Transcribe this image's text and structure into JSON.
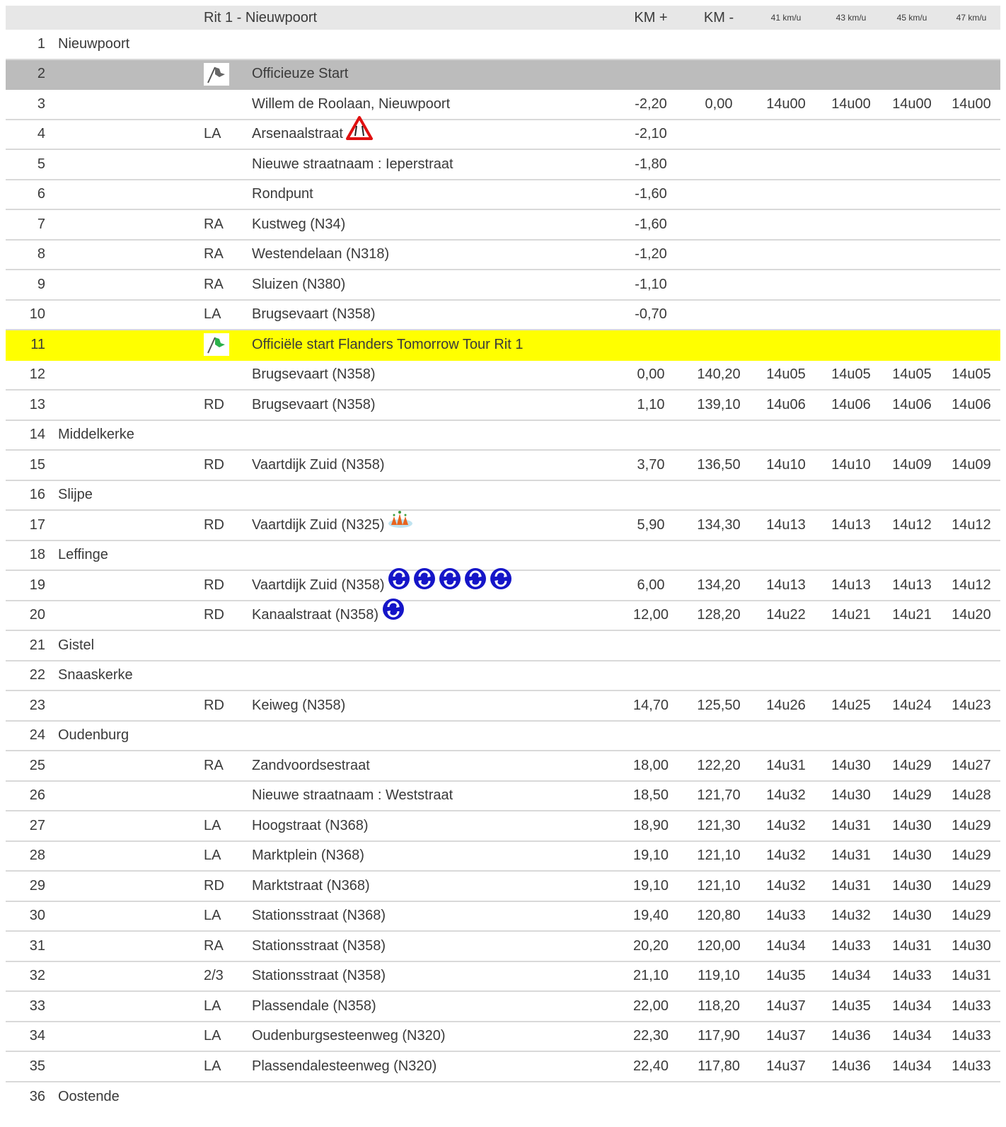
{
  "header": {
    "title": "Rit 1 - Nieuwpoort",
    "km_plus": "KM +",
    "km_minus": "KM -",
    "speeds": [
      "41 km/u",
      "43 km/u",
      "45 km/u",
      "47 km/u"
    ]
  },
  "rows": [
    {
      "n": "1",
      "place": "Nieuwpoort",
      "action": "",
      "street": "",
      "kmp": "",
      "kmm": "",
      "t": [
        "",
        "",
        "",
        ""
      ]
    },
    {
      "n": "2",
      "place": "",
      "action": "",
      "street": "Officieuze Start",
      "kmp": "",
      "kmm": "",
      "t": [
        "",
        "",
        "",
        ""
      ]
    },
    {
      "n": "3",
      "place": "",
      "action": "",
      "street": "Willem de Roolaan, Nieuwpoort",
      "kmp": "-2,20",
      "kmm": "0,00",
      "t": [
        "14u00",
        "14u00",
        "14u00",
        "14u00"
      ]
    },
    {
      "n": "4",
      "place": "",
      "action": "LA",
      "street": "Arsenaalstraat",
      "kmp": "-2,10",
      "kmm": "",
      "t": [
        "",
        "",
        "",
        ""
      ]
    },
    {
      "n": "5",
      "place": "",
      "action": "",
      "street": "Nieuwe straatnaam : Ieperstraat",
      "kmp": "-1,80",
      "kmm": "",
      "t": [
        "",
        "",
        "",
        ""
      ]
    },
    {
      "n": "6",
      "place": "",
      "action": "",
      "street": "Rondpunt",
      "kmp": "-1,60",
      "kmm": "",
      "t": [
        "",
        "",
        "",
        ""
      ]
    },
    {
      "n": "7",
      "place": "",
      "action": "RA",
      "street": "Kustweg (N34)",
      "kmp": "-1,60",
      "kmm": "",
      "t": [
        "",
        "",
        "",
        ""
      ]
    },
    {
      "n": "8",
      "place": "",
      "action": "RA",
      "street": "Westendelaan (N318)",
      "kmp": "-1,20",
      "kmm": "",
      "t": [
        "",
        "",
        "",
        ""
      ]
    },
    {
      "n": "9",
      "place": "",
      "action": "RA",
      "street": "Sluizen (N380)",
      "kmp": "-1,10",
      "kmm": "",
      "t": [
        "",
        "",
        "",
        ""
      ]
    },
    {
      "n": "10",
      "place": "",
      "action": "LA",
      "street": "Brugsevaart (N358)",
      "kmp": "-0,70",
      "kmm": "",
      "t": [
        "",
        "",
        "",
        ""
      ]
    },
    {
      "n": "11",
      "place": "",
      "action": "",
      "street": "Officiële start Flanders Tomorrow Tour Rit 1",
      "kmp": "",
      "kmm": "",
      "t": [
        "",
        "",
        "",
        ""
      ]
    },
    {
      "n": "12",
      "place": "",
      "action": "",
      "street": "Brugsevaart (N358)",
      "kmp": "0,00",
      "kmm": "140,20",
      "t": [
        "14u05",
        "14u05",
        "14u05",
        "14u05"
      ]
    },
    {
      "n": "13",
      "place": "",
      "action": "RD",
      "street": "Brugsevaart (N358)",
      "kmp": "1,10",
      "kmm": "139,10",
      "t": [
        "14u06",
        "14u06",
        "14u06",
        "14u06"
      ]
    },
    {
      "n": "14",
      "place": "Middelkerke",
      "action": "",
      "street": "",
      "kmp": "",
      "kmm": "",
      "t": [
        "",
        "",
        "",
        ""
      ]
    },
    {
      "n": "15",
      "place": "",
      "action": "RD",
      "street": "Vaartdijk Zuid (N358)",
      "kmp": "3,70",
      "kmm": "136,50",
      "t": [
        "14u10",
        "14u10",
        "14u09",
        "14u09"
      ]
    },
    {
      "n": "16",
      "place": "Slijpe",
      "action": "",
      "street": "",
      "kmp": "",
      "kmm": "",
      "t": [
        "",
        "",
        "",
        ""
      ]
    },
    {
      "n": "17",
      "place": "",
      "action": "RD",
      "street": "Vaartdijk Zuid (N325)",
      "kmp": "5,90",
      "kmm": "134,30",
      "t": [
        "14u13",
        "14u13",
        "14u12",
        "14u12"
      ]
    },
    {
      "n": "18",
      "place": "Leffinge",
      "action": "",
      "street": "",
      "kmp": "",
      "kmm": "",
      "t": [
        "",
        "",
        "",
        ""
      ]
    },
    {
      "n": "19",
      "place": "",
      "action": "RD",
      "street": "Vaartdijk Zuid (N358)",
      "kmp": "6,00",
      "kmm": "134,20",
      "t": [
        "14u13",
        "14u13",
        "14u13",
        "14u12"
      ]
    },
    {
      "n": "20",
      "place": "",
      "action": "RD",
      "street": "Kanaalstraat (N358)",
      "kmp": "12,00",
      "kmm": "128,20",
      "t": [
        "14u22",
        "14u21",
        "14u21",
        "14u20"
      ]
    },
    {
      "n": "21",
      "place": "Gistel",
      "action": "",
      "street": "",
      "kmp": "",
      "kmm": "",
      "t": [
        "",
        "",
        "",
        ""
      ]
    },
    {
      "n": "22",
      "place": "Snaaskerke",
      "action": "",
      "street": "",
      "kmp": "",
      "kmm": "",
      "t": [
        "",
        "",
        "",
        ""
      ]
    },
    {
      "n": "23",
      "place": "",
      "action": "RD",
      "street": "Keiweg (N358)",
      "kmp": "14,70",
      "kmm": "125,50",
      "t": [
        "14u26",
        "14u25",
        "14u24",
        "14u23"
      ]
    },
    {
      "n": "24",
      "place": "Oudenburg",
      "action": "",
      "street": "",
      "kmp": "",
      "kmm": "",
      "t": [
        "",
        "",
        "",
        ""
      ]
    },
    {
      "n": "25",
      "place": "",
      "action": "RA",
      "street": "Zandvoordsestraat",
      "kmp": "18,00",
      "kmm": "122,20",
      "t": [
        "14u31",
        "14u30",
        "14u29",
        "14u27"
      ]
    },
    {
      "n": "26",
      "place": "",
      "action": "",
      "street": "Nieuwe straatnaam : Weststraat",
      "kmp": "18,50",
      "kmm": "121,70",
      "t": [
        "14u32",
        "14u30",
        "14u29",
        "14u28"
      ]
    },
    {
      "n": "27",
      "place": "",
      "action": "LA",
      "street": "Hoogstraat (N368)",
      "kmp": "18,90",
      "kmm": "121,30",
      "t": [
        "14u32",
        "14u31",
        "14u30",
        "14u29"
      ]
    },
    {
      "n": "28",
      "place": "",
      "action": "LA",
      "street": "Marktplein (N368)",
      "kmp": "19,10",
      "kmm": "121,10",
      "t": [
        "14u32",
        "14u31",
        "14u30",
        "14u29"
      ]
    },
    {
      "n": "29",
      "place": "",
      "action": "RD",
      "street": "Marktstraat (N368)",
      "kmp": "19,10",
      "kmm": "121,10",
      "t": [
        "14u32",
        "14u31",
        "14u30",
        "14u29"
      ]
    },
    {
      "n": "30",
      "place": "",
      "action": "LA",
      "street": "Stationsstraat (N368)",
      "kmp": "19,40",
      "kmm": "120,80",
      "t": [
        "14u33",
        "14u32",
        "14u30",
        "14u29"
      ]
    },
    {
      "n": "31",
      "place": "",
      "action": "RA",
      "street": "Stationsstraat (N358)",
      "kmp": "20,20",
      "kmm": "120,00",
      "t": [
        "14u34",
        "14u33",
        "14u31",
        "14u30"
      ]
    },
    {
      "n": "32",
      "place": "",
      "action": "2/3",
      "street": "Stationsstraat (N358)",
      "kmp": "21,10",
      "kmm": "119,10",
      "t": [
        "14u35",
        "14u34",
        "14u33",
        "14u31"
      ]
    },
    {
      "n": "33",
      "place": "",
      "action": "LA",
      "street": "Plassendale (N358)",
      "kmp": "22,00",
      "kmm": "118,20",
      "t": [
        "14u37",
        "14u35",
        "14u34",
        "14u33"
      ]
    },
    {
      "n": "34",
      "place": "",
      "action": "LA",
      "street": "Oudenburgsesteenweg (N320)",
      "kmp": "22,30",
      "kmm": "117,90",
      "t": [
        "14u37",
        "14u36",
        "14u34",
        "14u33"
      ]
    },
    {
      "n": "35",
      "place": "",
      "action": "LA",
      "street": "Plassendalesteenweg (N320)",
      "kmp": "22,40",
      "kmm": "117,80",
      "t": [
        "14u37",
        "14u36",
        "14u34",
        "14u33"
      ]
    },
    {
      "n": "36",
      "place": "Oostende",
      "action": "",
      "street": "",
      "kmp": "",
      "kmm": "",
      "t": [
        "",
        "",
        "",
        ""
      ]
    }
  ],
  "row_styles": {
    "2": "grey",
    "11": "yellow"
  },
  "row_icons": {
    "2": {
      "flag": "flag-icon-grey"
    },
    "4": {
      "street": [
        "narrowing-road-warning-icon"
      ]
    },
    "11": {
      "flag": "flag-icon-green"
    },
    "17": {
      "street": [
        "roadworks-cones-icon"
      ]
    },
    "19": {
      "street": [
        "roundabout-sign-icon",
        "roundabout-sign-icon",
        "roundabout-sign-icon",
        "roundabout-sign-icon",
        "roundabout-sign-icon"
      ]
    },
    "20": {
      "street": [
        "roundabout-sign-icon"
      ]
    }
  },
  "colors": {
    "header_bg": "#e7e7e7",
    "grey_row": "#bcbcbc",
    "yellow_row": "#ffff00",
    "row_divider": "#d9d9d9",
    "text": "#3a3a3a",
    "warning_red": "#e01010",
    "sign_blue": "#1515c8"
  }
}
